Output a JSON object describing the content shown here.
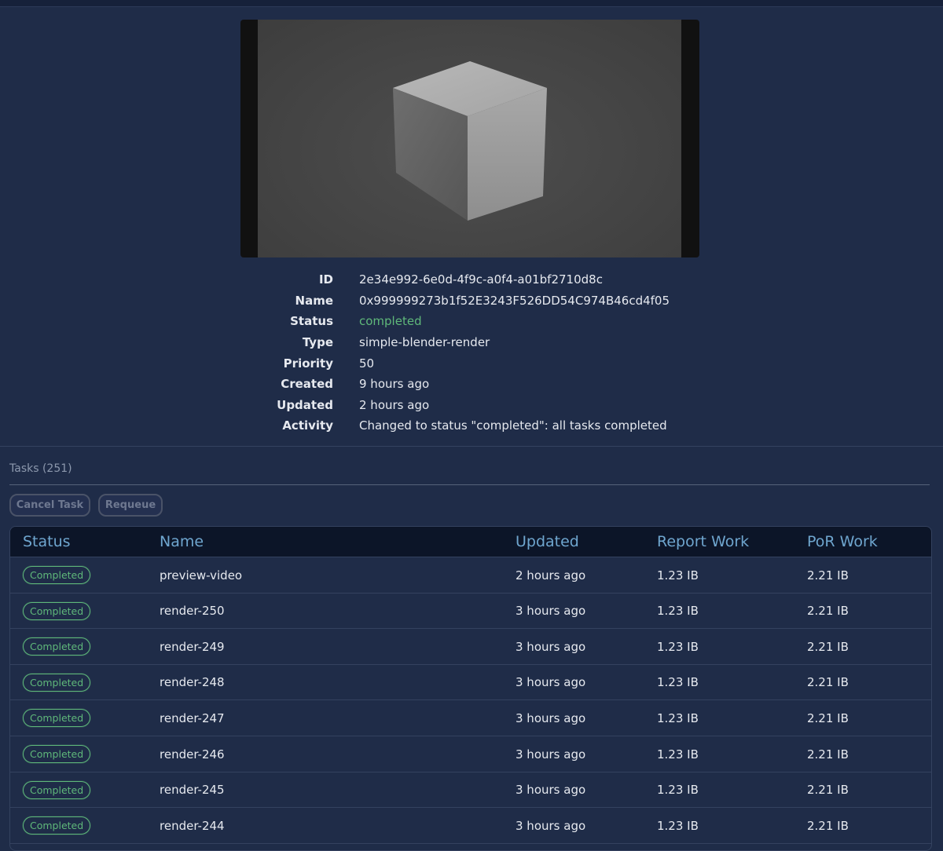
{
  "job": {
    "fields": [
      {
        "label": "ID",
        "value": "2e34e992-6e0d-4f9c-a0f4-a01bf2710d8c"
      },
      {
        "label": "Name",
        "value": "0x999999273b1f52E3243F526DD54C974B46cd4f05"
      },
      {
        "label": "Status",
        "value": "completed"
      },
      {
        "label": "Type",
        "value": "simple-blender-render"
      },
      {
        "label": "Priority",
        "value": "50"
      },
      {
        "label": "Created",
        "value": "9 hours ago"
      },
      {
        "label": "Updated",
        "value": "2 hours ago"
      },
      {
        "label": "Activity",
        "value": "Changed to status \"completed\": all tasks completed"
      }
    ]
  },
  "tasks": {
    "title": "Tasks (251)",
    "cancel_label": "Cancel Task",
    "requeue_label": "Requeue",
    "columns": [
      "Status",
      "Name",
      "Updated",
      "Report Work",
      "PoR Work"
    ],
    "rows": [
      {
        "status": "Completed",
        "name": "preview-video",
        "updated": "2 hours ago",
        "report": "1.23 IB",
        "por": "2.21 IB"
      },
      {
        "status": "Completed",
        "name": "render-250",
        "updated": "3 hours ago",
        "report": "1.23 IB",
        "por": "2.21 IB"
      },
      {
        "status": "Completed",
        "name": "render-249",
        "updated": "3 hours ago",
        "report": "1.23 IB",
        "por": "2.21 IB"
      },
      {
        "status": "Completed",
        "name": "render-248",
        "updated": "3 hours ago",
        "report": "1.23 IB",
        "por": "2.21 IB"
      },
      {
        "status": "Completed",
        "name": "render-247",
        "updated": "3 hours ago",
        "report": "1.23 IB",
        "por": "2.21 IB"
      },
      {
        "status": "Completed",
        "name": "render-246",
        "updated": "3 hours ago",
        "report": "1.23 IB",
        "por": "2.21 IB"
      },
      {
        "status": "Completed",
        "name": "render-245",
        "updated": "3 hours ago",
        "report": "1.23 IB",
        "por": "2.21 IB"
      },
      {
        "status": "Completed",
        "name": "render-244",
        "updated": "3 hours ago",
        "report": "1.23 IB",
        "por": "2.21 IB"
      }
    ]
  },
  "colors": {
    "background": "#1f2c48",
    "header_bg": "#0c1528",
    "accent": "#6fa6cf",
    "status_completed": "#5fb87a"
  }
}
